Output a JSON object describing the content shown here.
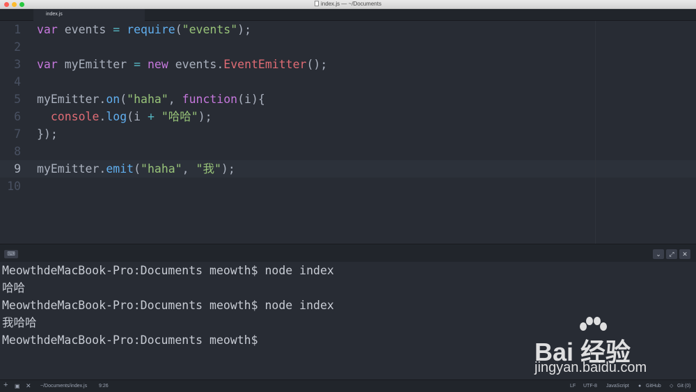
{
  "window": {
    "title": "index.js — ~/Documents"
  },
  "tabs": [
    {
      "label": "index.js"
    }
  ],
  "editor": {
    "line_numbers": [
      "1",
      "2",
      "3",
      "4",
      "5",
      "6",
      "7",
      "8",
      "9",
      "10"
    ],
    "lines": [
      [
        {
          "t": "var",
          "c": "kw"
        },
        {
          "t": " events ",
          "c": ""
        },
        {
          "t": "=",
          "c": "op"
        },
        {
          "t": " ",
          "c": ""
        },
        {
          "t": "require",
          "c": "fn"
        },
        {
          "t": "(",
          "c": ""
        },
        {
          "t": "\"events\"",
          "c": "str"
        },
        {
          "t": ");",
          "c": ""
        }
      ],
      [],
      [
        {
          "t": "var",
          "c": "kw"
        },
        {
          "t": " myEmitter ",
          "c": ""
        },
        {
          "t": "=",
          "c": "op"
        },
        {
          "t": " ",
          "c": ""
        },
        {
          "t": "new",
          "c": "kw"
        },
        {
          "t": " events.",
          "c": ""
        },
        {
          "t": "EventEmitter",
          "c": "cls"
        },
        {
          "t": "();",
          "c": ""
        }
      ],
      [],
      [
        {
          "t": "myEmitter.",
          "c": ""
        },
        {
          "t": "on",
          "c": "fn"
        },
        {
          "t": "(",
          "c": ""
        },
        {
          "t": "\"haha\"",
          "c": "str"
        },
        {
          "t": ", ",
          "c": ""
        },
        {
          "t": "function",
          "c": "kw"
        },
        {
          "t": "(i){",
          "c": ""
        }
      ],
      [
        {
          "t": "  ",
          "c": ""
        },
        {
          "t": "console",
          "c": "obj"
        },
        {
          "t": ".",
          "c": ""
        },
        {
          "t": "log",
          "c": "fn"
        },
        {
          "t": "(i ",
          "c": ""
        },
        {
          "t": "+",
          "c": "op"
        },
        {
          "t": " ",
          "c": ""
        },
        {
          "t": "\"哈哈\"",
          "c": "str"
        },
        {
          "t": ");",
          "c": ""
        }
      ],
      [
        {
          "t": "});",
          "c": ""
        }
      ],
      [],
      [
        {
          "t": "myEmitter.",
          "c": ""
        },
        {
          "t": "emit",
          "c": "fn"
        },
        {
          "t": "(",
          "c": ""
        },
        {
          "t": "\"haha\"",
          "c": "str"
        },
        {
          "t": ", ",
          "c": ""
        },
        {
          "t": "\"我\"",
          "c": "str"
        },
        {
          "t": ");",
          "c": ""
        }
      ],
      []
    ],
    "active_line": 9
  },
  "terminal": {
    "lines": [
      "MeowthdeMacBook-Pro:Documents meowth$ node index",
      "哈哈",
      "MeowthdeMacBook-Pro:Documents meowth$ node index",
      "我哈哈",
      "MeowthdeMacBook-Pro:Documents meowth$"
    ]
  },
  "watermark": {
    "brand": "Bai 经验",
    "url": "jingyan.baidu.com"
  },
  "statusbar": {
    "file_path": "~/Documents/index.js",
    "cursor": "9:26",
    "line_ending": "LF",
    "encoding": "UTF-8",
    "grammar": "JavaScript",
    "github": "GitHub",
    "git": "Git (0)"
  },
  "colors": {
    "editor_bg": "#282c34",
    "keyword": "#c678dd",
    "string": "#98c379",
    "function": "#61afef",
    "class": "#e06c75",
    "operator": "#56b6c2"
  }
}
